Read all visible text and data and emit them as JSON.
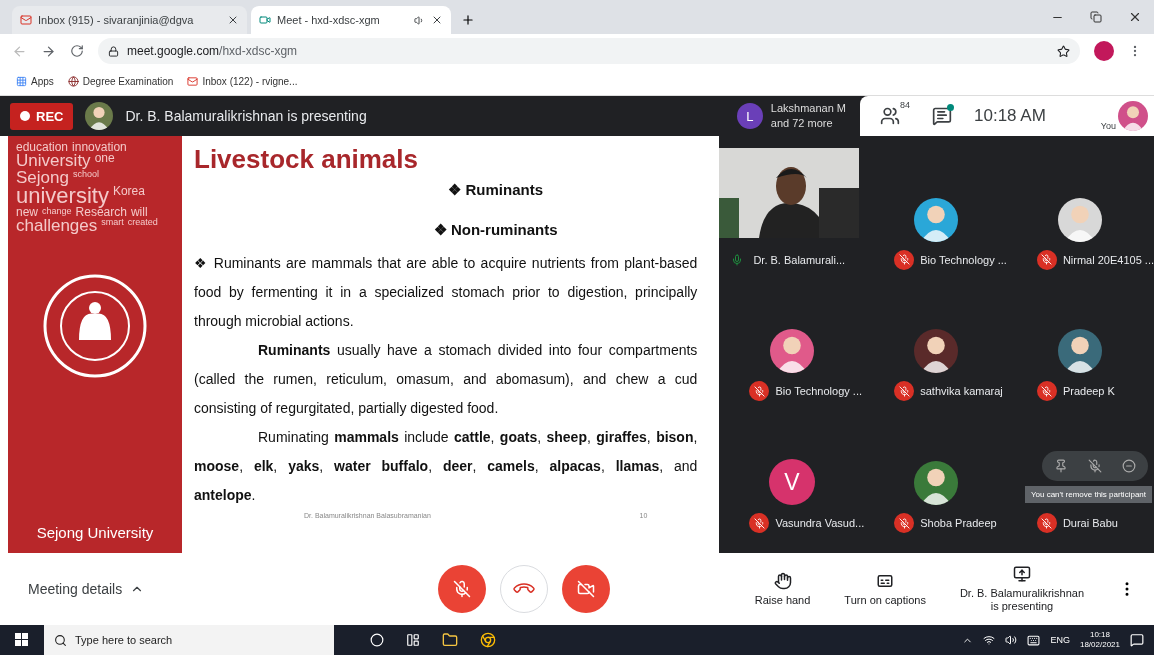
{
  "browser": {
    "tabs": [
      {
        "title": "Inbox (915) - sivaranjinia@dgva",
        "selected": false
      },
      {
        "title": "Meet - hxd-xdsc-xgm",
        "selected": true
      }
    ],
    "url_domain": "meet.google.com",
    "url_path": "/hxd-xdsc-xgm",
    "bookmarks": [
      {
        "label": "Apps"
      },
      {
        "label": "Degree Examination"
      },
      {
        "label": "Inbox (122) - rvigne..."
      }
    ]
  },
  "meet_header": {
    "rec": "REC",
    "presenting": "Dr. B. Balamuralikrishnan is presenting",
    "other_initial": "L",
    "other_line1": "Lakshmanan M",
    "other_line2": "and 72 more",
    "people_count": "84",
    "time": "10:18 AM",
    "you": "You",
    "chat_unread": true
  },
  "slide": {
    "cloud": [
      "education",
      "innovation",
      "University",
      "one",
      "Sejong",
      "school",
      "university",
      "Korea",
      "new",
      "change",
      "Research",
      "will",
      "challenges",
      "smart",
      "created"
    ],
    "university": "Sejong University",
    "title": "Livestock animals",
    "bullets": [
      {
        "marker": "❖",
        "text": "Ruminants"
      },
      {
        "marker": "❖",
        "text": "Non-ruminants"
      }
    ],
    "paragraphs": [
      {
        "marker": "❖",
        "text": "Ruminants are mammals that are able to acquire nutrients from plant-based food by fermenting it in a specialized stomach prior to digestion, principally through microbial actions."
      },
      {
        "text": "**Ruminants** usually have a stomach divided into four compartments (called the rumen, reticulum, omasum, and abomasum), and chew a cud consisting of regurgitated, partially digested food."
      },
      {
        "text": "Ruminating **mammals** include **cattle**, **goats**, **sheep**, **giraffes**, **bison**, **moose**, **elk**, **yaks**, **water buffalo**, **deer**, **camels**, **alpacas**, **llamas**, and **antelope**."
      }
    ],
    "footer": "Dr. Balamuralikrishnan Balasubramanian",
    "page": "10"
  },
  "participants": [
    {
      "name": "Dr. B. Balamurali...",
      "kind": "video",
      "muted": false
    },
    {
      "name": "Bio Technology ...",
      "color": "#2aa7d8",
      "muted": true
    },
    {
      "name": "Nirmal 20E4105 ...",
      "color": "#d8d8d8",
      "muted": true
    },
    {
      "name": "Bio Technology ...",
      "color": "#e05a8a",
      "muted": true
    },
    {
      "name": "sathvika kamaraj",
      "color": "#5a2a2a",
      "muted": true
    },
    {
      "name": "Pradeep K",
      "color": "#3a6a7a",
      "muted": true
    },
    {
      "name": "Vasundra Vasud...",
      "kind": "letter",
      "initial": "V",
      "color": "#d6336c",
      "muted": true
    },
    {
      "name": "Shoba Pradeep",
      "color": "#3a7a3a",
      "muted": true
    },
    {
      "name": "Durai Babu",
      "kind": "hover",
      "muted": true,
      "tooltip": "You can't remove this participant"
    }
  ],
  "bottom_bar": {
    "details": "Meeting details",
    "actions": [
      {
        "label": "Raise hand"
      },
      {
        "label": "Turn on captions"
      }
    ],
    "presenting_line1": "Dr. B. Balamuralikrishnan",
    "presenting_line2": "is presenting"
  },
  "taskbar": {
    "search": "Type here to search",
    "lang": "ENG",
    "time": "10:18",
    "date": "18/02/2021"
  }
}
